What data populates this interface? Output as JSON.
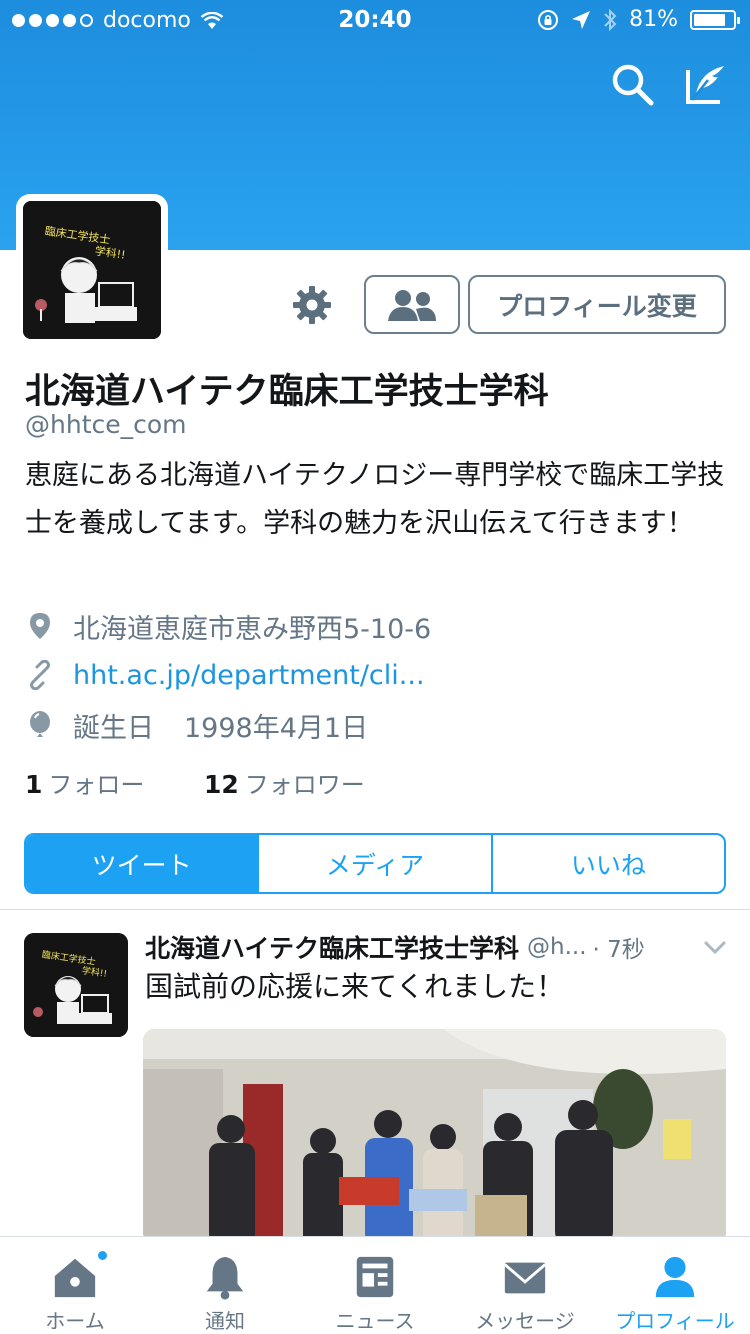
{
  "status_bar": {
    "carrier": "docomo",
    "time": "20:40",
    "battery_pct": "81%",
    "battery_level": 0.81,
    "signal_bars": 4
  },
  "header": {
    "search_icon": "search-icon",
    "compose_icon": "compose-icon",
    "color": "#1d8ddd"
  },
  "profile": {
    "avatar_text": "臨床工学技士学科!!",
    "buttons": {
      "settings_icon": "gear-icon",
      "people_icon": "people-icon",
      "edit_label": "プロフィール変更"
    },
    "name": "北海道ハイテク臨床工学技士学科",
    "handle": "@hhtce_com",
    "bio": "恵庭にある北海道ハイテクノロジー専門学校で臨床工学技士を養成してます。学科の魅力を沢山伝えて行きます！",
    "location": "北海道恵庭市恵み野西5-10-6",
    "url": "hht.ac.jp/department/cli...",
    "birthday_label": "誕生日",
    "birthday": "1998年4月1日",
    "following_count": "1",
    "following_label": "フォロー",
    "followers_count": "12",
    "followers_label": "フォロワー"
  },
  "tabs": [
    {
      "label": "ツイート",
      "active": true
    },
    {
      "label": "メディア",
      "active": false
    },
    {
      "label": "いいね",
      "active": false
    }
  ],
  "tweet": {
    "name": "北海道ハイテク臨床工学技士学科",
    "handle": "@h...",
    "time": "· 7秒",
    "text": "国試前の応援に来てくれました！"
  },
  "tabbar": [
    {
      "label": "ホーム",
      "icon": "home-icon",
      "active": false,
      "badge": true
    },
    {
      "label": "通知",
      "icon": "bell-icon",
      "active": false
    },
    {
      "label": "ニュース",
      "icon": "news-icon",
      "active": false
    },
    {
      "label": "メッセージ",
      "icon": "mail-icon",
      "active": false
    },
    {
      "label": "プロフィール",
      "icon": "person-icon",
      "active": true
    }
  ],
  "colors": {
    "accent": "#1da1f2",
    "text": "#14171a",
    "secondary": "#657786"
  }
}
